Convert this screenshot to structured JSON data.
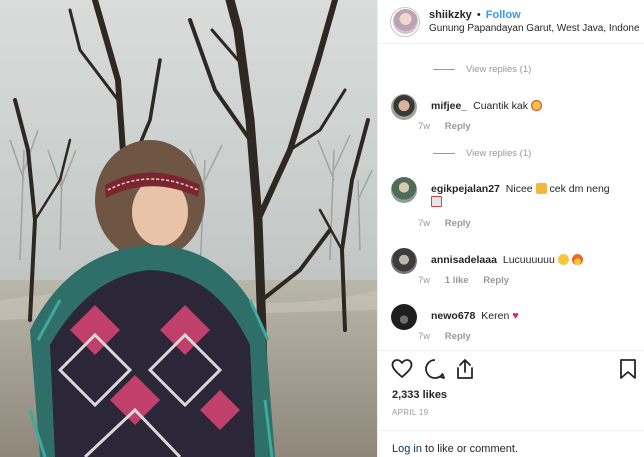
{
  "header": {
    "username": "shiikzky",
    "separator": "•",
    "follow_label": "Follow",
    "location": "Gunung Papandayan Garut, West Java, Indone..."
  },
  "comments": {
    "view_replies_1": "View replies (1)",
    "view_replies_2": "View replies (1)",
    "items": [
      {
        "user": "mifjee_",
        "text": "Cuantik kak",
        "emoji": "heart-eyes-emoji",
        "time": "7w",
        "likes": "",
        "reply": "Reply"
      },
      {
        "user": "egikpejalan27",
        "text": "Nicee",
        "text2": "cek dm neng",
        "emoji": "thumbs-up-emoji",
        "time": "7w",
        "likes": "",
        "reply": "Reply"
      },
      {
        "user": "annisadelaaa",
        "text": "Lucuuuuuu",
        "emoji": "smile-fire-emoji",
        "time": "7w",
        "likes": "1 like",
        "reply": "Reply"
      },
      {
        "user": "newo678",
        "text": "Keren",
        "emoji": "red-heart-emoji",
        "time": "7w",
        "likes": "",
        "reply": "Reply"
      }
    ]
  },
  "footer": {
    "likes": "2,333 likes",
    "date": "APRIL 19",
    "login_link": "Log in",
    "login_suffix": "to like or comment."
  },
  "icons": [
    "heart-icon",
    "comment-icon",
    "share-icon",
    "bookmark-icon"
  ],
  "colors": {
    "follow": "#3897f0",
    "meta": "#999999",
    "heart": "#ed4956"
  }
}
